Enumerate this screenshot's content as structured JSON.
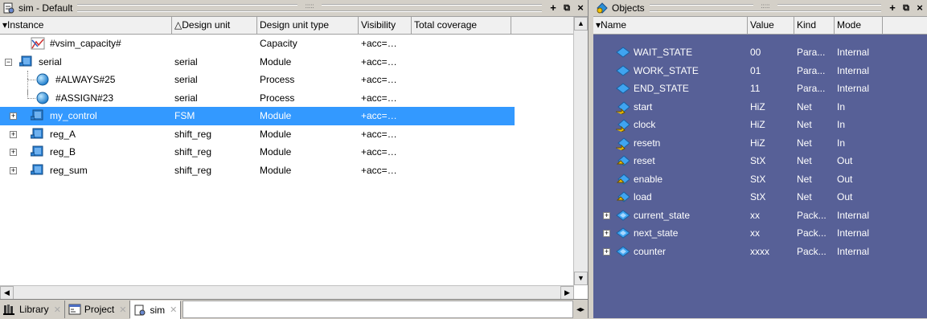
{
  "sim_pane": {
    "title": "sim - Default",
    "columns": [
      "Instance",
      "Design unit",
      "Design unit type",
      "Visibility",
      "Total coverage"
    ],
    "rows": [
      {
        "name": "#vsim_capacity#",
        "unit": "",
        "type": "Capacity",
        "vis": "+acc=…",
        "icon": "capacity-icon",
        "indent": 1,
        "expander": ""
      },
      {
        "name": "serial",
        "unit": "serial",
        "type": "Module",
        "vis": "+acc=…",
        "icon": "module-icon",
        "indent": 0,
        "expander": "−"
      },
      {
        "name": "#ALWAYS#25",
        "unit": "serial",
        "type": "Process",
        "vis": "+acc=…",
        "icon": "process-icon",
        "indent": 2,
        "expander": ""
      },
      {
        "name": "#ASSIGN#23",
        "unit": "serial",
        "type": "Process",
        "vis": "+acc=…",
        "icon": "process-icon",
        "indent": 2,
        "expander": ""
      },
      {
        "name": "my_control",
        "unit": "FSM",
        "type": "Module",
        "vis": "+acc=…",
        "icon": "module-icon",
        "indent": 1,
        "expander": "+"
      },
      {
        "name": "reg_A",
        "unit": "shift_reg",
        "type": "Module",
        "vis": "+acc=…",
        "icon": "module-icon",
        "indent": 1,
        "expander": "+"
      },
      {
        "name": "reg_B",
        "unit": "shift_reg",
        "type": "Module",
        "vis": "+acc=…",
        "icon": "module-icon",
        "indent": 1,
        "expander": "+"
      },
      {
        "name": "reg_sum",
        "unit": "shift_reg",
        "type": "Module",
        "vis": "+acc=…",
        "icon": "module-icon",
        "indent": 1,
        "expander": "+"
      }
    ],
    "selected_row": "my_control",
    "tabs": [
      {
        "label": "Library",
        "icon": "library-icon",
        "active": false
      },
      {
        "label": "Project",
        "icon": "project-icon",
        "active": false
      },
      {
        "label": "sim",
        "icon": "sim-icon",
        "active": true
      }
    ]
  },
  "objects_pane": {
    "title": "Objects",
    "columns": [
      "Name",
      "Value",
      "Kind",
      "Mode"
    ],
    "rows": [
      {
        "name": "WAIT_STATE",
        "value": "00",
        "kind": "Para...",
        "mode": "Internal",
        "icon": "parameter-icon",
        "expander": ""
      },
      {
        "name": "WORK_STATE",
        "value": "01",
        "kind": "Para...",
        "mode": "Internal",
        "icon": "parameter-icon",
        "expander": ""
      },
      {
        "name": "END_STATE",
        "value": "11",
        "kind": "Para...",
        "mode": "Internal",
        "icon": "parameter-icon",
        "expander": ""
      },
      {
        "name": "start",
        "value": "HiZ",
        "kind": "Net",
        "mode": "In",
        "icon": "net-in-icon",
        "expander": ""
      },
      {
        "name": "clock",
        "value": "HiZ",
        "kind": "Net",
        "mode": "In",
        "icon": "net-in-icon",
        "expander": ""
      },
      {
        "name": "resetn",
        "value": "HiZ",
        "kind": "Net",
        "mode": "In",
        "icon": "net-in-icon",
        "expander": ""
      },
      {
        "name": "reset",
        "value": "StX",
        "kind": "Net",
        "mode": "Out",
        "icon": "net-out-icon",
        "expander": ""
      },
      {
        "name": "enable",
        "value": "StX",
        "kind": "Net",
        "mode": "Out",
        "icon": "net-out-icon",
        "expander": ""
      },
      {
        "name": "load",
        "value": "StX",
        "kind": "Net",
        "mode": "Out",
        "icon": "net-out-icon",
        "expander": ""
      },
      {
        "name": "current_state",
        "value": "xx",
        "kind": "Pack...",
        "mode": "Internal",
        "icon": "packed-icon",
        "expander": "+"
      },
      {
        "name": "next_state",
        "value": "xx",
        "kind": "Pack...",
        "mode": "Internal",
        "icon": "packed-icon",
        "expander": "+"
      },
      {
        "name": "counter",
        "value": "xxxx",
        "kind": "Pack...",
        "mode": "Internal",
        "icon": "packed-icon",
        "expander": "+"
      }
    ]
  },
  "colors": {
    "selection": "#3399ff",
    "objects_bg": "#576097"
  }
}
